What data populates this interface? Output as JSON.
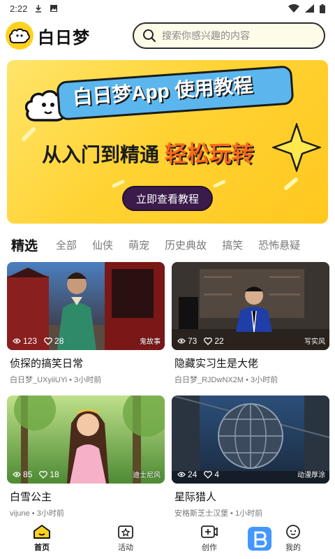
{
  "status_bar": {
    "time": "2:22"
  },
  "header": {
    "app_name": "白日梦",
    "search_placeholder": "搜索你感兴趣的内容"
  },
  "banner": {
    "title": "白日梦App 使用教程",
    "subtitle_plain": "从入门到精通",
    "subtitle_highlight": "轻松玩转",
    "button_label": "立即查看教程"
  },
  "tabs": [
    "精选",
    "全部",
    "仙侠",
    "萌宠",
    "历史典故",
    "搞笑",
    "恐怖悬疑"
  ],
  "cards": [
    {
      "title": "侦探的搞笑日常",
      "author": "白日梦_UXyiiUYi",
      "time": "3小时前",
      "views": "123",
      "likes": "28",
      "tag": "鬼故事"
    },
    {
      "title": "隐藏实习生是大佬",
      "author": "白日梦_RJDwNX2M",
      "time": "3小时前",
      "views": "73",
      "likes": "22",
      "tag": "写实风"
    },
    {
      "title": "白雪公主",
      "author": "vijune",
      "time": "3小时前",
      "views": "85",
      "likes": "18",
      "tag": "迪士尼风"
    },
    {
      "title": "星际猎人",
      "author": "安格斯芝士汉堡",
      "time": "1小时前",
      "views": "24",
      "likes": "4",
      "tag": "动漫厚涂"
    }
  ],
  "bottom_nav": [
    {
      "label": "首页",
      "icon": "home-icon",
      "active": true
    },
    {
      "label": "活动",
      "icon": "activity-icon",
      "active": false
    },
    {
      "label": "创作",
      "icon": "create-icon",
      "active": false
    },
    {
      "label": "我的",
      "icon": "profile-icon",
      "active": false
    }
  ],
  "colors": {
    "brand_yellow": "#ffd21f",
    "banner_blue": "#5bb6ee",
    "banner_orange": "#ff6a1a",
    "button_purple": "#3a1b4a"
  }
}
